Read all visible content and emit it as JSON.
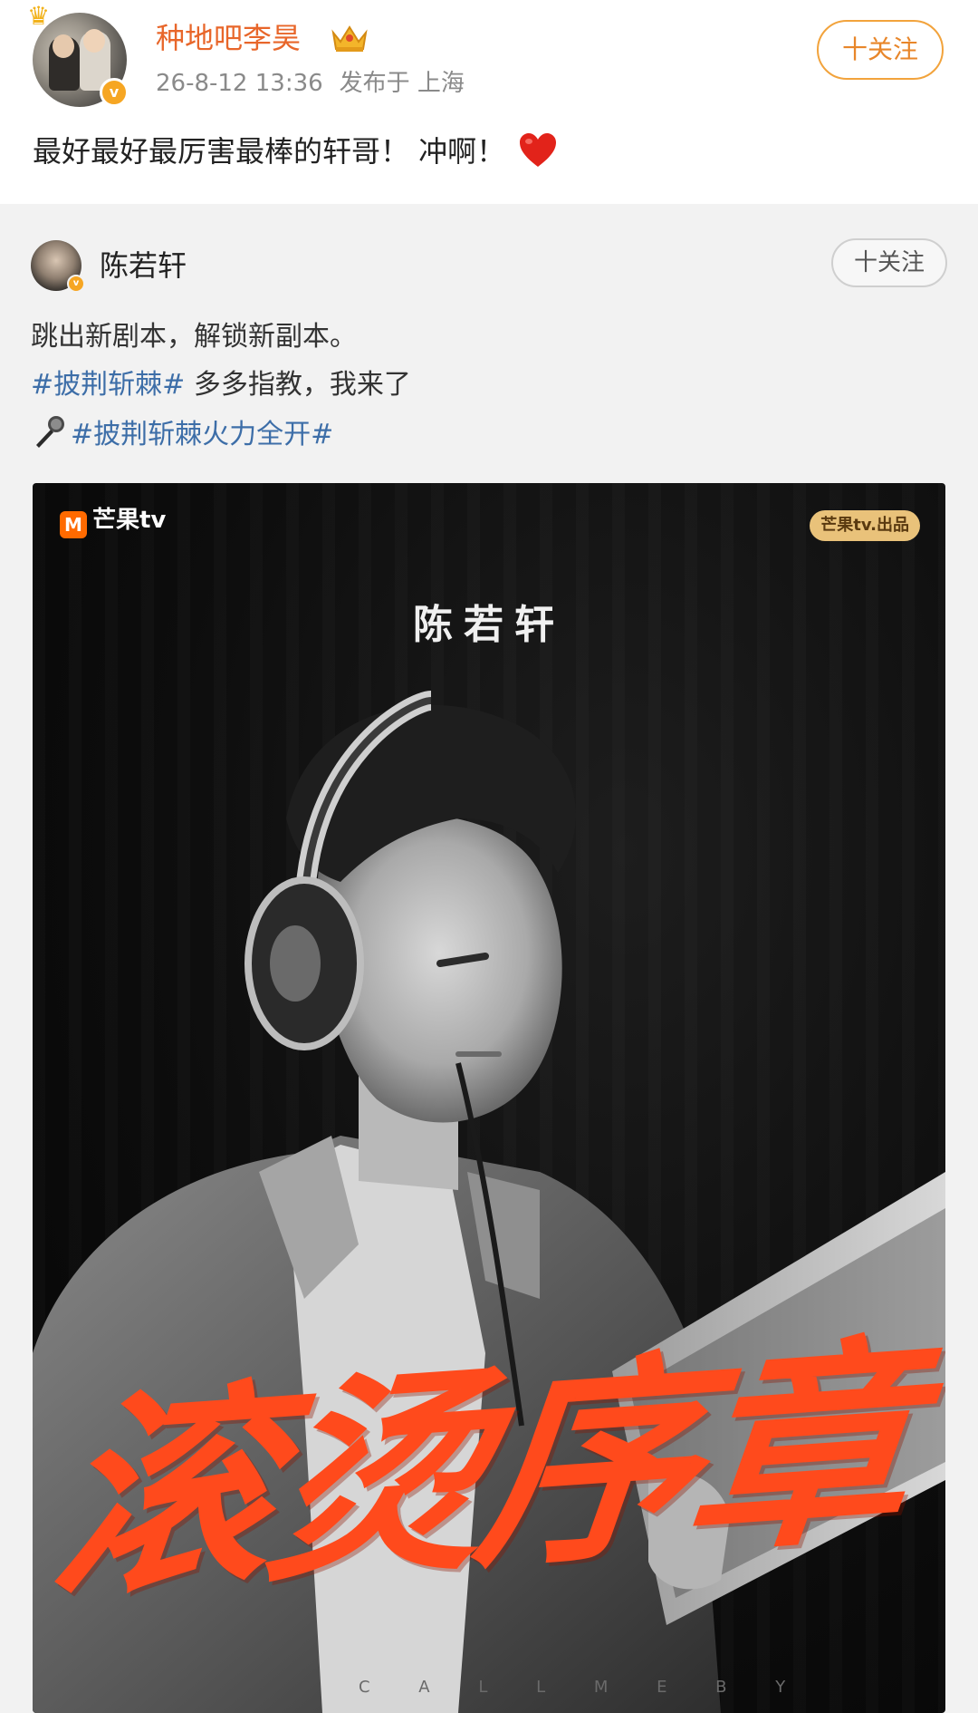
{
  "post": {
    "author": "种地吧李昊",
    "timestamp": "26-8-12 13:36",
    "location": "发布于 上海",
    "follow_label": "十关注",
    "text": "最好最好最厉害最棒的轩哥！ 冲啊！",
    "verified_badge": "v"
  },
  "repost": {
    "author": "陈若轩",
    "follow_label": "十关注",
    "line1": "跳出新剧本，解锁新副本。",
    "line2_tag": "#披荆斩棘#",
    "line2_rest": " 多多指教，我来了",
    "line3_tag": "#披荆斩棘火力全开#",
    "verified_badge": "v"
  },
  "poster": {
    "logo_text": "芒果tv",
    "logo_mark": "M",
    "badge_text": "芒果tv.出品",
    "name": "陈若轩",
    "title_art": "滚烫序章",
    "caption": "C A L L  M E   B Y"
  },
  "colors": {
    "author_orange": "#e8662a",
    "tag_blue": "#3d6ea8",
    "title_red": "#ff4a1c"
  }
}
